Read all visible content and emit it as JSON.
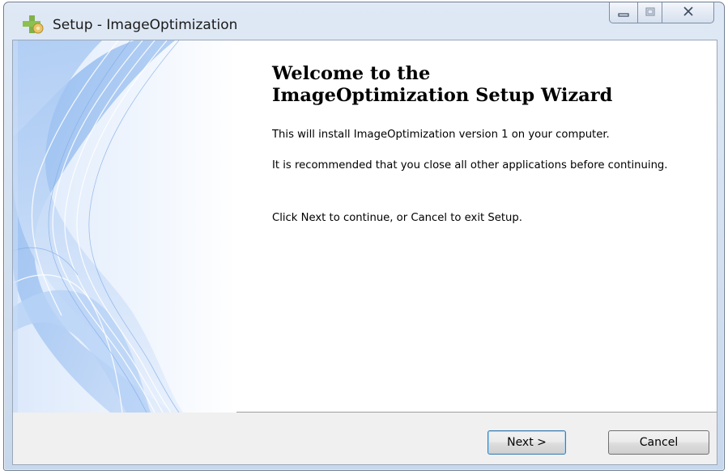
{
  "window": {
    "title": "Setup - ImageOptimization",
    "controls": {
      "minimize": "minimize-icon",
      "maximize": "maximize-icon",
      "close": "close-icon"
    }
  },
  "wizard": {
    "heading_line1": "Welcome to the",
    "heading_line2": "ImageOptimization Setup Wizard",
    "paragraphs": [
      "This will install ImageOptimization version 1 on your computer.",
      "It is recommended that you close all other applications before continuing.",
      "Click Next to continue, or Cancel to exit Setup."
    ]
  },
  "buttons": {
    "next": "Next >",
    "cancel": "Cancel"
  },
  "colors": {
    "wave_blue": "#9cc3f0",
    "frame": "#c8d8ec"
  }
}
